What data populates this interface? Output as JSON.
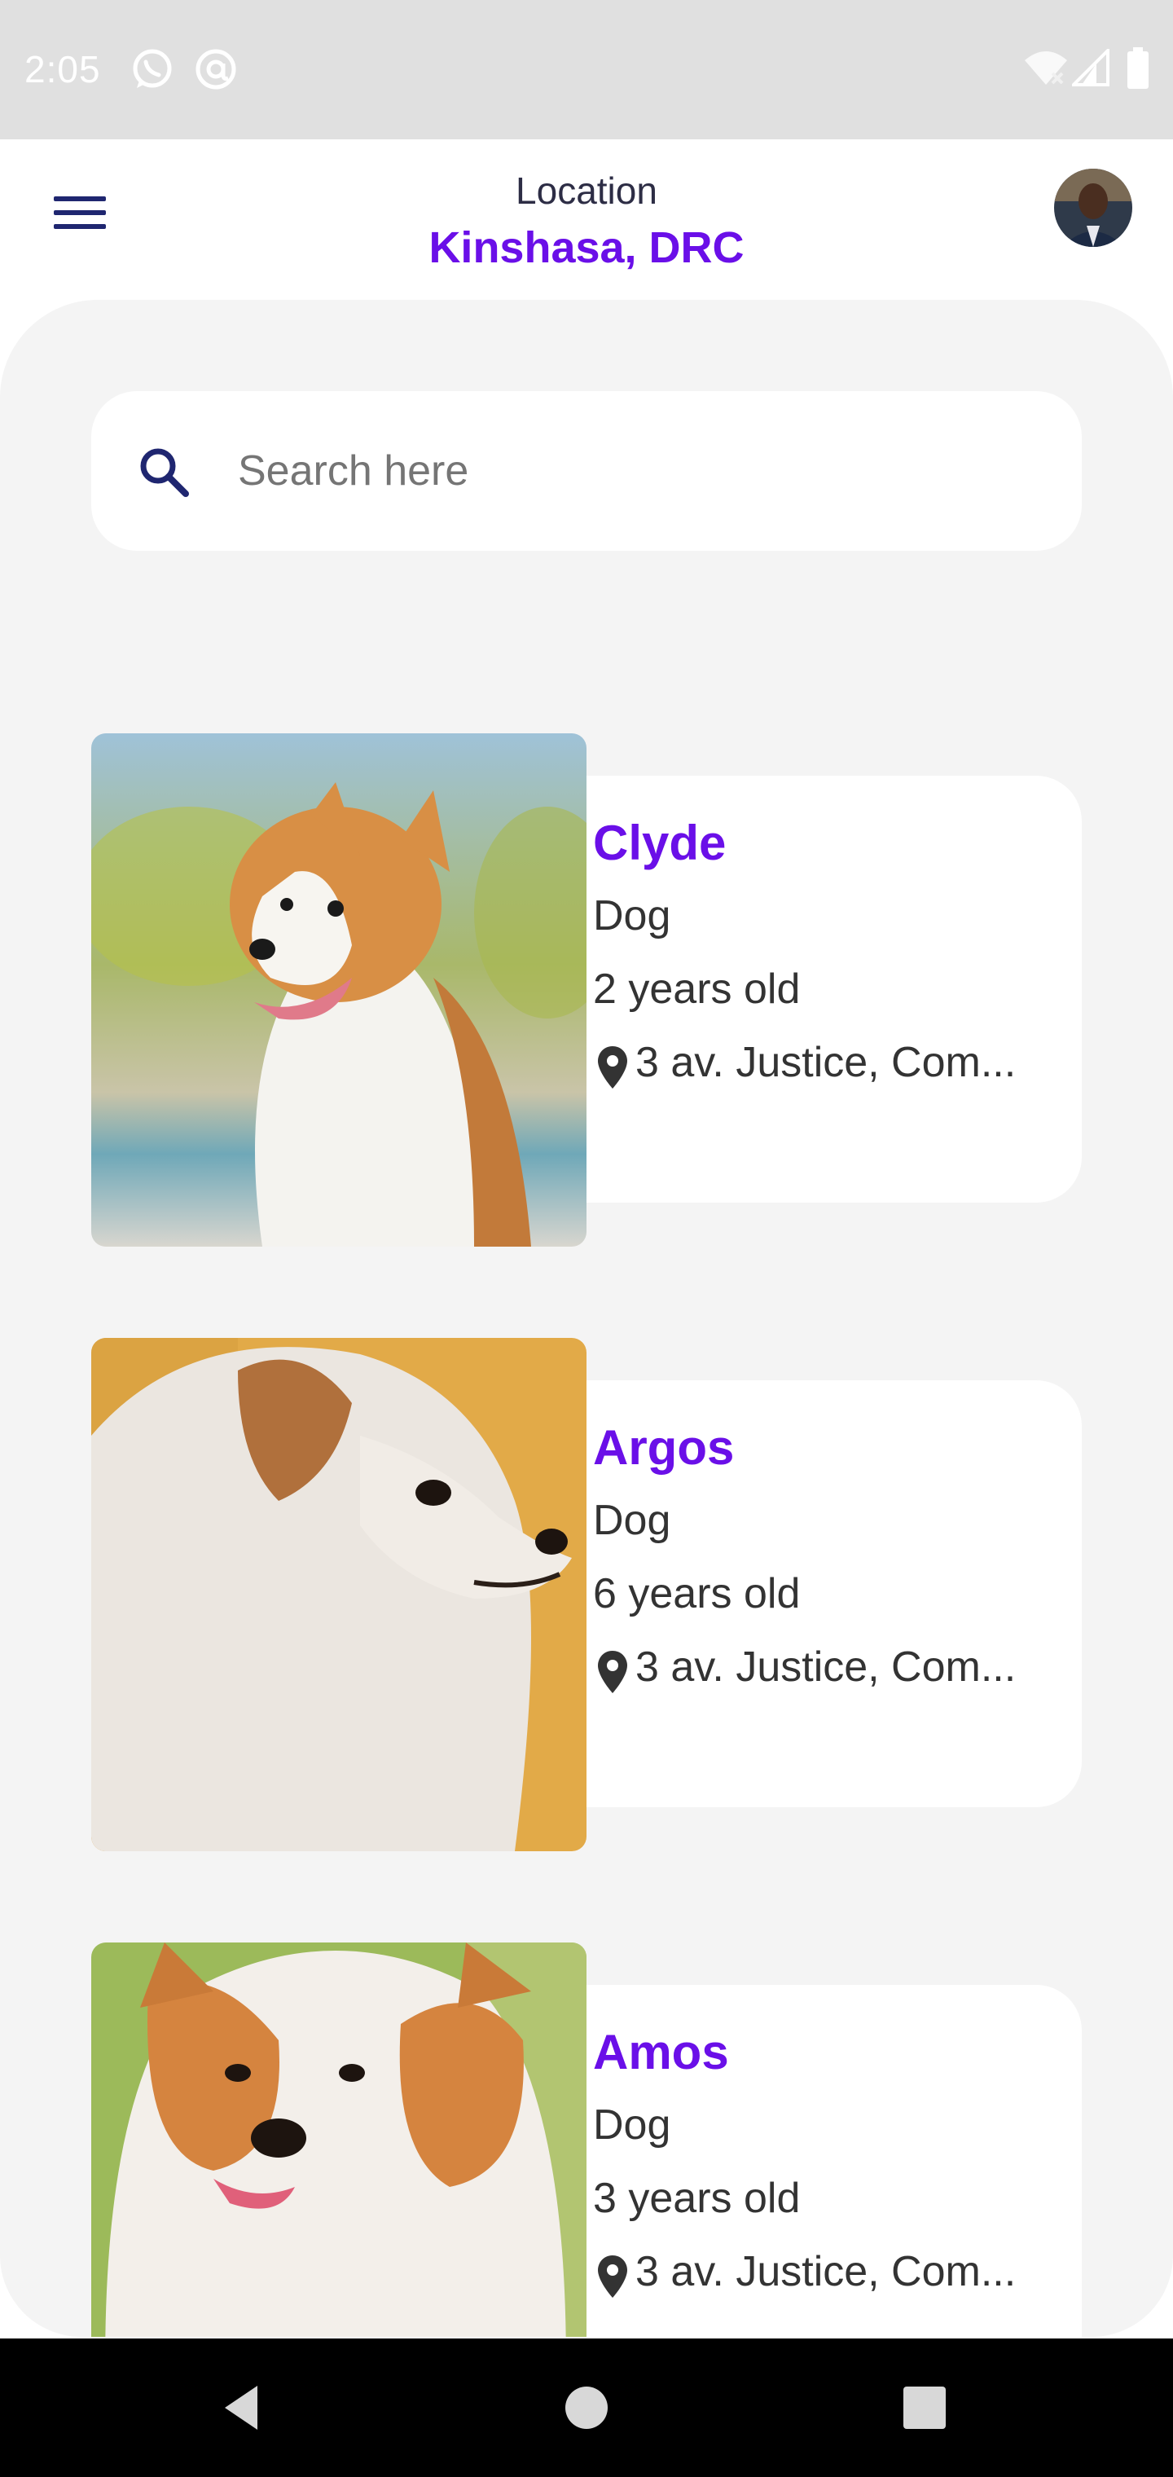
{
  "status_bar": {
    "time": "2:05",
    "icons": [
      "whatsapp-icon",
      "at-sign-icon",
      "wifi-off-icon",
      "signal-icon",
      "battery-icon"
    ]
  },
  "header": {
    "menu_icon": "hamburger-menu-icon",
    "location_label": "Location",
    "location_value": "Kinshasa, DRC",
    "avatar": "user-avatar"
  },
  "search": {
    "placeholder": "Search here",
    "value": "",
    "icon": "search-icon"
  },
  "pets": [
    {
      "name": "Clyde",
      "type": "Dog",
      "age": "2 years old",
      "address": "3 av. Justice, Com..."
    },
    {
      "name": "Argos",
      "type": "Dog",
      "age": "6 years old",
      "address": "3 av. Justice, Com..."
    },
    {
      "name": "Amos",
      "type": "Dog",
      "age": "3 years old",
      "address": "3 av. Justice, Com..."
    }
  ],
  "colors": {
    "accent": "#6a0fe8",
    "navy": "#1f2670",
    "background": "#f4f4f4"
  },
  "nav_bar": [
    "back-icon",
    "home-icon",
    "recents-icon"
  ]
}
